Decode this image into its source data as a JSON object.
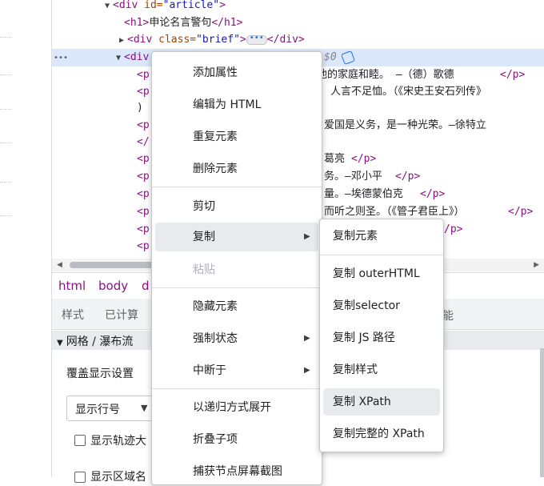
{
  "elements": {
    "lines": [
      {
        "triangle": "▼",
        "open_tag": "<div",
        "attr": " id=",
        "value": "\"article\"",
        "close": ">"
      },
      {
        "tag_open": "<h1>",
        "text": "申论名言警句",
        "tag_close": "</h1>"
      },
      {
        "triangle": "▶",
        "open_tag": "<div",
        "attr": " class=",
        "value": "\"brief\"",
        "close": ">",
        "badge": "•••",
        "end_tag": "</div>"
      },
      {
        "gutter": "•••",
        "triangle": "▼",
        "tag": "<div",
        "dollar": "$0"
      }
    ],
    "p_rows": [
      {
        "tag": "<p",
        "text": "为他的家庭和睦。 —（德）歌德",
        "end": "</p>"
      },
      {
        "tag": "<p",
        "text": "人言不足恤。（《宋史王安石列传》",
        "end": ""
      },
      {
        "tag": ")",
        "text": "",
        "end": ""
      },
      {
        "tag": "<p",
        "text": "爱国是义务，是一种光荣。—徐特立",
        "end": ""
      },
      {
        "tag": "</",
        "text": "",
        "end": ""
      },
      {
        "tag": "<p",
        "text": "葛亮",
        "end": "</p>"
      },
      {
        "tag": "<p",
        "text": "务。—邓小平",
        "end": "</p>"
      },
      {
        "tag": "<p",
        "text": "量。—埃德蒙伯克",
        "end": "</p>"
      },
      {
        "tag": "<p",
        "text": "而听之则圣。（《管子君臣上》）",
        "end": "</p>"
      },
      {
        "tag": "<p",
        "text": "",
        "end": "/p>"
      },
      {
        "tag": "<p",
        "text": "",
        "end": ""
      }
    ]
  },
  "breadcrumb": [
    "html",
    "body",
    "d"
  ],
  "style_tabs": [
    "样式",
    "已计算"
  ],
  "energy_tab": "能",
  "section_title": "网格 / 瀑布流",
  "overlay_label": "覆盖显示设置",
  "line_select": {
    "value": "显示行号"
  },
  "checkboxes": [
    "显示轨迹大",
    "显示区域名"
  ],
  "context_menu": {
    "items": [
      {
        "label": "添加属性"
      },
      {
        "label": "编辑为 HTML"
      },
      {
        "label": "重复元素"
      },
      {
        "label": "删除元素"
      },
      {
        "label": "剪切"
      },
      {
        "label": "复制",
        "submenu": true,
        "highlighted": true
      },
      {
        "label": "粘贴",
        "disabled": true
      },
      {
        "label": "隐藏元素"
      },
      {
        "label": "强制状态",
        "submenu": true
      },
      {
        "label": "中断于",
        "submenu": true
      },
      {
        "label": "以递归方式展开"
      },
      {
        "label": "折叠子项"
      },
      {
        "label": "捕获节点屏幕截图"
      }
    ]
  },
  "copy_submenu": {
    "items": [
      {
        "label": "复制元素"
      },
      {
        "label": "复制 outerHTML"
      },
      {
        "label": "复制selector"
      },
      {
        "label": "复制 JS 路径"
      },
      {
        "label": "复制样式"
      },
      {
        "label": "复制 XPath",
        "highlighted": true
      },
      {
        "label": "复制完整的 XPath"
      }
    ]
  },
  "colors": {
    "selected_row": "#dbe8fc",
    "tag": "#881280",
    "attr": "#994500",
    "value": "#1a1aa6",
    "menu_highlight": "#e8eaed"
  }
}
